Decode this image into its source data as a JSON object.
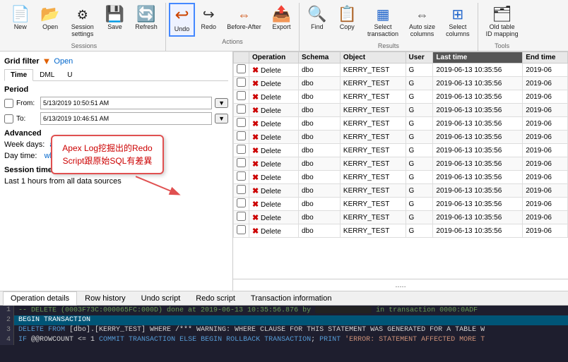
{
  "toolbar": {
    "sections": [
      {
        "name": "Sessions",
        "buttons": [
          {
            "id": "new",
            "label": "New",
            "icon": "icon-new"
          },
          {
            "id": "open",
            "label": "Open",
            "icon": "icon-open"
          },
          {
            "id": "session-settings",
            "label": "Session\nsettings",
            "icon": "icon-session"
          },
          {
            "id": "save",
            "label": "Save",
            "icon": "icon-save"
          },
          {
            "id": "refresh",
            "label": "Refresh",
            "icon": "icon-refresh"
          }
        ]
      },
      {
        "name": "Actions",
        "buttons": [
          {
            "id": "undo",
            "label": "Undo",
            "icon": "icon-undo"
          },
          {
            "id": "redo",
            "label": "Redo",
            "icon": "icon-redo"
          },
          {
            "id": "before-after",
            "label": "Before-After",
            "icon": "icon-beforeafter"
          },
          {
            "id": "export",
            "label": "Export",
            "icon": "icon-export"
          }
        ]
      },
      {
        "name": "Results",
        "buttons": [
          {
            "id": "find",
            "label": "Find",
            "icon": "icon-find"
          },
          {
            "id": "copy",
            "label": "Copy",
            "icon": "icon-copy"
          },
          {
            "id": "select-transaction",
            "label": "Select\ntransaction",
            "icon": "icon-select-trans"
          },
          {
            "id": "auto-size-columns",
            "label": "Auto size\ncolumns",
            "icon": "icon-autosize"
          },
          {
            "id": "select-columns",
            "label": "Select\ncolumns",
            "icon": "icon-select-cols"
          }
        ]
      },
      {
        "name": "Tools",
        "buttons": [
          {
            "id": "old-table-id",
            "label": "Old table\nID mapping",
            "icon": "icon-oldtable"
          }
        ]
      }
    ]
  },
  "left_panel": {
    "title": "Grid filter",
    "open_label": "Open",
    "tabs": [
      "Time",
      "DML",
      "U"
    ],
    "period_label": "Period",
    "from_label": "From:",
    "from_value": "5/13/2019 10:50:51 AM",
    "to_label": "To:",
    "to_value": "6/13/2019 10:46:51 AM",
    "advanced_label": "Advanced",
    "week_days_label": "Week days:",
    "week_days_value": "all",
    "day_time_label": "Day time:",
    "day_time_value": "whole day",
    "session_time_label": "Session time",
    "session_time_desc": "Last 1 hours from all data sources"
  },
  "tooltip": {
    "text": "Apex Log挖掘出的Redo\nScript跟原始SQL有差異"
  },
  "table": {
    "columns": [
      "",
      "Operation",
      "Schema",
      "Object",
      "User",
      "Last time",
      "End time"
    ],
    "rows": [
      {
        "op": "Delete",
        "schema": "dbo",
        "object": "KERRY_TEST",
        "user": "G",
        "last_time": "2019-06-13 10:35:56",
        "end_time": "2019-06"
      },
      {
        "op": "Delete",
        "schema": "dbo",
        "object": "KERRY_TEST",
        "user": "G",
        "last_time": "2019-06-13 10:35:56",
        "end_time": "2019-06"
      },
      {
        "op": "Delete",
        "schema": "dbo",
        "object": "KERRY_TEST",
        "user": "G",
        "last_time": "2019-06-13 10:35:56",
        "end_time": "2019-06"
      },
      {
        "op": "Delete",
        "schema": "dbo",
        "object": "KERRY_TEST",
        "user": "G",
        "last_time": "2019-06-13 10:35:56",
        "end_time": "2019-06"
      },
      {
        "op": "Delete",
        "schema": "dbo",
        "object": "KERRY_TEST",
        "user": "G",
        "last_time": "2019-06-13 10:35:56",
        "end_time": "2019-06"
      },
      {
        "op": "Delete",
        "schema": "dbo",
        "object": "KERRY_TEST",
        "user": "G",
        "last_time": "2019-06-13 10:35:56",
        "end_time": "2019-06"
      },
      {
        "op": "Delete",
        "schema": "dbo",
        "object": "KERRY_TEST",
        "user": "G",
        "last_time": "2019-06-13 10:35:56",
        "end_time": "2019-06"
      },
      {
        "op": "Delete",
        "schema": "dbo",
        "object": "KERRY_TEST",
        "user": "G",
        "last_time": "2019-06-13 10:35:56",
        "end_time": "2019-06"
      },
      {
        "op": "Delete",
        "schema": "dbo",
        "object": "KERRY_TEST",
        "user": "G",
        "last_time": "2019-06-13 10:35:56",
        "end_time": "2019-06"
      },
      {
        "op": "Delete",
        "schema": "dbo",
        "object": "KERRY_TEST",
        "user": "G",
        "last_time": "2019-06-13 10:35:56",
        "end_time": "2019-06"
      },
      {
        "op": "Delete",
        "schema": "dbo",
        "object": "KERRY_TEST",
        "user": "G",
        "last_time": "2019-06-13 10:35:56",
        "end_time": "2019-06"
      },
      {
        "op": "Delete",
        "schema": "dbo",
        "object": "KERRY_TEST",
        "user": "G",
        "last_time": "2019-06-13 10:35:56",
        "end_time": "2019-06"
      },
      {
        "op": "Delete",
        "schema": "dbo",
        "object": "KERRY_TEST",
        "user": "G",
        "last_time": "2019-06-13 10:35:56",
        "end_time": "2019-06"
      }
    ]
  },
  "scroll_indicator": ".....",
  "bottom_tabs": [
    {
      "id": "operation-details",
      "label": "Operation details"
    },
    {
      "id": "row-history",
      "label": "Row history"
    },
    {
      "id": "undo-script",
      "label": "Undo script"
    },
    {
      "id": "redo-script",
      "label": "Redo script"
    },
    {
      "id": "transaction-info",
      "label": "Transaction information"
    }
  ],
  "code_lines": [
    {
      "num": "1",
      "content": "-- DELETE (0003F73C:000065FC:000D) done at 2019-06-13 10:35:56.876 by [REDACTED] in transaction 0000:0ADF",
      "type": "comment"
    },
    {
      "num": "2",
      "content": "BEGIN TRANSACTION",
      "type": "highlight-begin"
    },
    {
      "num": "3",
      "content": "DELETE FROM [dbo].[KERRY_TEST] WHERE /*** WARNING: WHERE CLAUSE FOR THIS STATEMENT WAS GENERATED FOR A TABLE W",
      "type": "normal"
    },
    {
      "num": "4",
      "content": "IF @@ROWCOUNT <= 1 COMMIT TRANSACTION ELSE BEGIN ROLLBACK TRANSACTION; PRINT 'ERROR: STATEMENT AFFECTED MORE T",
      "type": "normal"
    }
  ]
}
